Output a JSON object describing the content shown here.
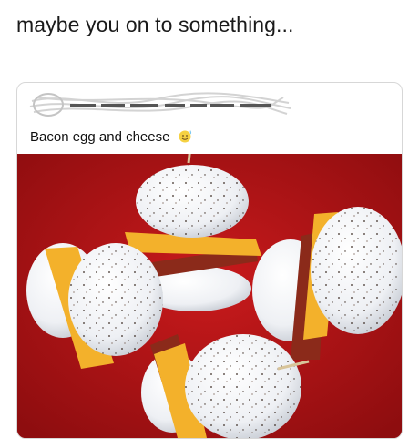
{
  "caption": "maybe you on to something...",
  "post": {
    "text": "Bacon egg and cheese",
    "emoji_icon": "sweat-smile-emoji-icon",
    "author_redacted": true
  },
  "photo": {
    "subject": "bacon-egg-cheese-bites-icon",
    "background_color": "#b81618"
  }
}
